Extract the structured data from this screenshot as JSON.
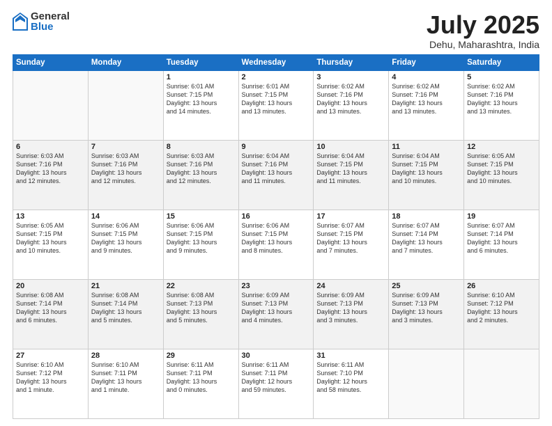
{
  "logo": {
    "general": "General",
    "blue": "Blue"
  },
  "title": "July 2025",
  "location": "Dehu, Maharashtra, India",
  "days_of_week": [
    "Sunday",
    "Monday",
    "Tuesday",
    "Wednesday",
    "Thursday",
    "Friday",
    "Saturday"
  ],
  "weeks": [
    [
      {
        "day": "",
        "info": ""
      },
      {
        "day": "",
        "info": ""
      },
      {
        "day": "1",
        "info": "Sunrise: 6:01 AM\nSunset: 7:15 PM\nDaylight: 13 hours\nand 14 minutes."
      },
      {
        "day": "2",
        "info": "Sunrise: 6:01 AM\nSunset: 7:15 PM\nDaylight: 13 hours\nand 13 minutes."
      },
      {
        "day": "3",
        "info": "Sunrise: 6:02 AM\nSunset: 7:16 PM\nDaylight: 13 hours\nand 13 minutes."
      },
      {
        "day": "4",
        "info": "Sunrise: 6:02 AM\nSunset: 7:16 PM\nDaylight: 13 hours\nand 13 minutes."
      },
      {
        "day": "5",
        "info": "Sunrise: 6:02 AM\nSunset: 7:16 PM\nDaylight: 13 hours\nand 13 minutes."
      }
    ],
    [
      {
        "day": "6",
        "info": "Sunrise: 6:03 AM\nSunset: 7:16 PM\nDaylight: 13 hours\nand 12 minutes."
      },
      {
        "day": "7",
        "info": "Sunrise: 6:03 AM\nSunset: 7:16 PM\nDaylight: 13 hours\nand 12 minutes."
      },
      {
        "day": "8",
        "info": "Sunrise: 6:03 AM\nSunset: 7:16 PM\nDaylight: 13 hours\nand 12 minutes."
      },
      {
        "day": "9",
        "info": "Sunrise: 6:04 AM\nSunset: 7:16 PM\nDaylight: 13 hours\nand 11 minutes."
      },
      {
        "day": "10",
        "info": "Sunrise: 6:04 AM\nSunset: 7:15 PM\nDaylight: 13 hours\nand 11 minutes."
      },
      {
        "day": "11",
        "info": "Sunrise: 6:04 AM\nSunset: 7:15 PM\nDaylight: 13 hours\nand 10 minutes."
      },
      {
        "day": "12",
        "info": "Sunrise: 6:05 AM\nSunset: 7:15 PM\nDaylight: 13 hours\nand 10 minutes."
      }
    ],
    [
      {
        "day": "13",
        "info": "Sunrise: 6:05 AM\nSunset: 7:15 PM\nDaylight: 13 hours\nand 10 minutes."
      },
      {
        "day": "14",
        "info": "Sunrise: 6:06 AM\nSunset: 7:15 PM\nDaylight: 13 hours\nand 9 minutes."
      },
      {
        "day": "15",
        "info": "Sunrise: 6:06 AM\nSunset: 7:15 PM\nDaylight: 13 hours\nand 9 minutes."
      },
      {
        "day": "16",
        "info": "Sunrise: 6:06 AM\nSunset: 7:15 PM\nDaylight: 13 hours\nand 8 minutes."
      },
      {
        "day": "17",
        "info": "Sunrise: 6:07 AM\nSunset: 7:15 PM\nDaylight: 13 hours\nand 7 minutes."
      },
      {
        "day": "18",
        "info": "Sunrise: 6:07 AM\nSunset: 7:14 PM\nDaylight: 13 hours\nand 7 minutes."
      },
      {
        "day": "19",
        "info": "Sunrise: 6:07 AM\nSunset: 7:14 PM\nDaylight: 13 hours\nand 6 minutes."
      }
    ],
    [
      {
        "day": "20",
        "info": "Sunrise: 6:08 AM\nSunset: 7:14 PM\nDaylight: 13 hours\nand 6 minutes."
      },
      {
        "day": "21",
        "info": "Sunrise: 6:08 AM\nSunset: 7:14 PM\nDaylight: 13 hours\nand 5 minutes."
      },
      {
        "day": "22",
        "info": "Sunrise: 6:08 AM\nSunset: 7:13 PM\nDaylight: 13 hours\nand 5 minutes."
      },
      {
        "day": "23",
        "info": "Sunrise: 6:09 AM\nSunset: 7:13 PM\nDaylight: 13 hours\nand 4 minutes."
      },
      {
        "day": "24",
        "info": "Sunrise: 6:09 AM\nSunset: 7:13 PM\nDaylight: 13 hours\nand 3 minutes."
      },
      {
        "day": "25",
        "info": "Sunrise: 6:09 AM\nSunset: 7:13 PM\nDaylight: 13 hours\nand 3 minutes."
      },
      {
        "day": "26",
        "info": "Sunrise: 6:10 AM\nSunset: 7:12 PM\nDaylight: 13 hours\nand 2 minutes."
      }
    ],
    [
      {
        "day": "27",
        "info": "Sunrise: 6:10 AM\nSunset: 7:12 PM\nDaylight: 13 hours\nand 1 minute."
      },
      {
        "day": "28",
        "info": "Sunrise: 6:10 AM\nSunset: 7:11 PM\nDaylight: 13 hours\nand 1 minute."
      },
      {
        "day": "29",
        "info": "Sunrise: 6:11 AM\nSunset: 7:11 PM\nDaylight: 13 hours\nand 0 minutes."
      },
      {
        "day": "30",
        "info": "Sunrise: 6:11 AM\nSunset: 7:11 PM\nDaylight: 12 hours\nand 59 minutes."
      },
      {
        "day": "31",
        "info": "Sunrise: 6:11 AM\nSunset: 7:10 PM\nDaylight: 12 hours\nand 58 minutes."
      },
      {
        "day": "",
        "info": ""
      },
      {
        "day": "",
        "info": ""
      }
    ]
  ]
}
